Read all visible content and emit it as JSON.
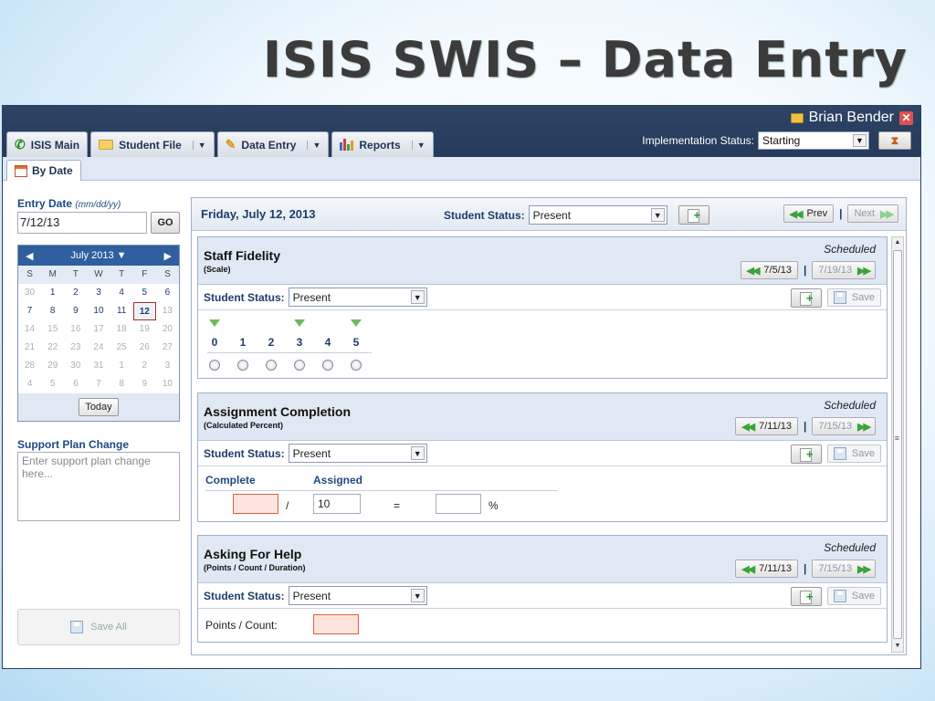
{
  "slide_title": "ISIS SWIS – Data Entry",
  "user": {
    "name": "Brian Bender"
  },
  "implementation": {
    "label": "Implementation Status:",
    "value": "Starting"
  },
  "nav_tabs": [
    {
      "label": "ISIS Main"
    },
    {
      "label": "Student File"
    },
    {
      "label": "Data Entry"
    },
    {
      "label": "Reports"
    }
  ],
  "subtab": {
    "label": "By Date"
  },
  "entry_date": {
    "label": "Entry Date",
    "hint": "(mm/dd/yy)",
    "value": "7/12/13",
    "go": "GO"
  },
  "calendar": {
    "month_label": "July 2013",
    "dow": [
      "S",
      "M",
      "T",
      "W",
      "T",
      "F",
      "S"
    ],
    "weeks": [
      [
        [
          "30",
          "oth"
        ],
        [
          "1",
          "cur"
        ],
        [
          "2",
          "cur"
        ],
        [
          "3",
          "cur"
        ],
        [
          "4",
          "cur"
        ],
        [
          "5",
          "cur"
        ],
        [
          "6",
          "cur"
        ]
      ],
      [
        [
          "7",
          "cur"
        ],
        [
          "8",
          "cur"
        ],
        [
          "9",
          "cur"
        ],
        [
          "10",
          "cur"
        ],
        [
          "11",
          "cur"
        ],
        [
          "12",
          "sel"
        ],
        [
          "13",
          "oth"
        ]
      ],
      [
        [
          "14",
          "oth"
        ],
        [
          "15",
          "oth"
        ],
        [
          "16",
          "oth"
        ],
        [
          "17",
          "oth"
        ],
        [
          "18",
          "oth"
        ],
        [
          "19",
          "oth"
        ],
        [
          "20",
          "oth"
        ]
      ],
      [
        [
          "21",
          "oth"
        ],
        [
          "22",
          "oth"
        ],
        [
          "23",
          "oth"
        ],
        [
          "24",
          "oth"
        ],
        [
          "25",
          "oth"
        ],
        [
          "26",
          "oth"
        ],
        [
          "27",
          "oth"
        ]
      ],
      [
        [
          "28",
          "oth"
        ],
        [
          "29",
          "oth"
        ],
        [
          "30",
          "oth"
        ],
        [
          "31",
          "oth"
        ],
        [
          "1",
          "oth"
        ],
        [
          "2",
          "oth"
        ],
        [
          "3",
          "oth"
        ]
      ],
      [
        [
          "4",
          "oth"
        ],
        [
          "5",
          "oth"
        ],
        [
          "6",
          "oth"
        ],
        [
          "7",
          "oth"
        ],
        [
          "8",
          "oth"
        ],
        [
          "9",
          "oth"
        ],
        [
          "10",
          "oth"
        ]
      ]
    ],
    "today": "Today"
  },
  "support_plan": {
    "label": "Support Plan Change",
    "placeholder": "Enter support plan change here..."
  },
  "save_all": "Save All",
  "main": {
    "date": "Friday, July 12, 2013",
    "status_label": "Student Status:",
    "status_value": "Present",
    "prev": "Prev",
    "next": "Next"
  },
  "cards": {
    "fidelity": {
      "title": "Staff Fidelity",
      "subtitle": "(Scale)",
      "scheduled": "Scheduled",
      "prev_date": "7/5/13",
      "next_date": "7/19/13",
      "status_label": "Student Status:",
      "status_value": "Present",
      "save": "Save",
      "scale": [
        "0",
        "1",
        "2",
        "3",
        "4",
        "5"
      ]
    },
    "assignment": {
      "title": "Assignment Completion",
      "subtitle": "(Calculated Percent)",
      "scheduled": "Scheduled",
      "prev_date": "7/11/13",
      "next_date": "7/15/13",
      "status_label": "Student Status:",
      "status_value": "Present",
      "save": "Save",
      "complete_label": "Complete",
      "assigned_label": "Assigned",
      "complete_value": "",
      "assigned_value": "10",
      "percent_value": "",
      "slash": "/",
      "equals": "=",
      "percent": "%"
    },
    "help": {
      "title": "Asking For Help",
      "subtitle": "(Points / Count / Duration)",
      "scheduled": "Scheduled",
      "prev_date": "7/11/13",
      "next_date": "7/15/13",
      "status_label": "Student Status:",
      "status_value": "Present",
      "save": "Save",
      "points_label": "Points / Count:",
      "points_value": ""
    }
  }
}
